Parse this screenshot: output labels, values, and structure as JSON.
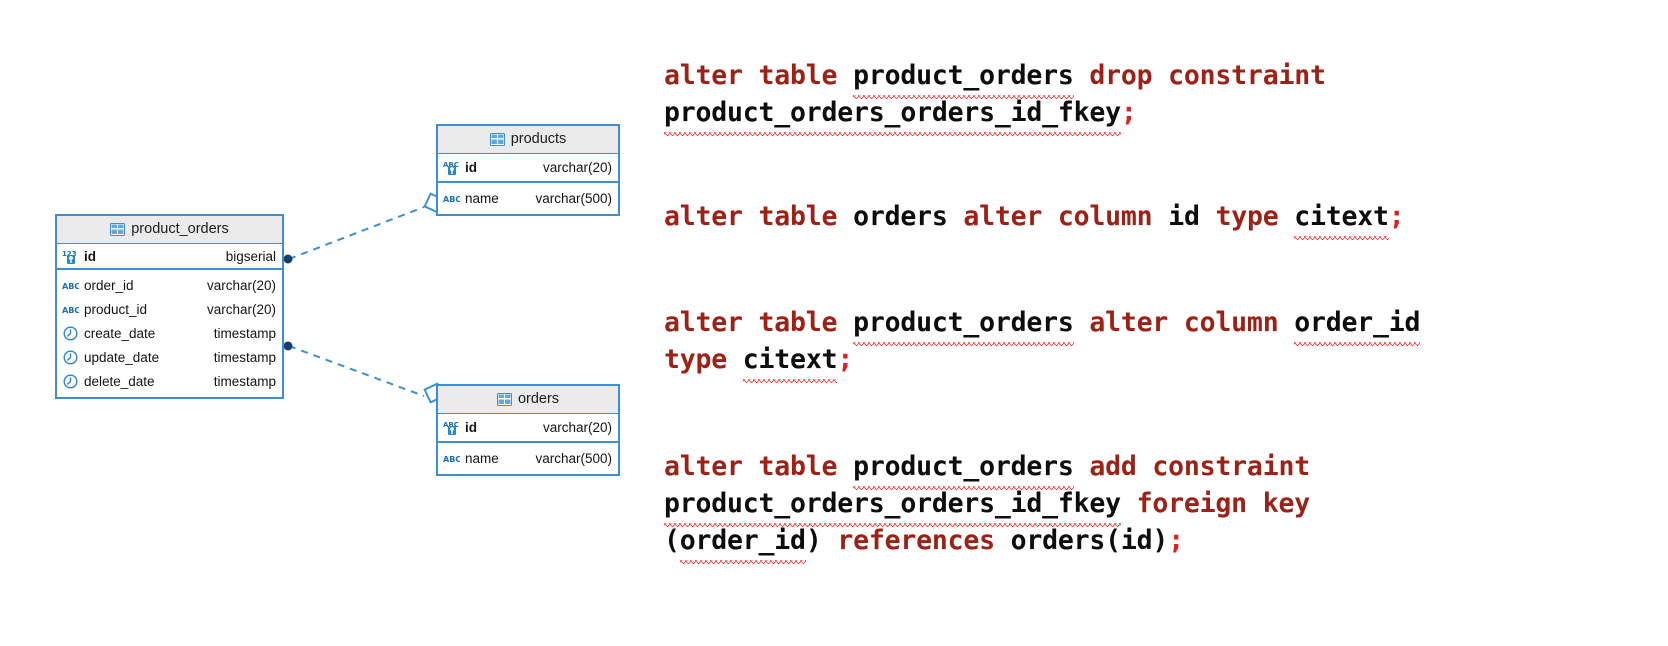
{
  "diagram": {
    "title": "er-diagram",
    "accent_color": "#3f8fd0",
    "header_bg": "#ebebeb",
    "entities": [
      {
        "name": "product_orders",
        "icon": "table-icon",
        "pk": {
          "icon": "number-key-icon",
          "name": "id",
          "type": "bigserial"
        },
        "columns": [
          {
            "icon": "abc-icon",
            "name": "order_id",
            "type": "varchar(20)"
          },
          {
            "icon": "abc-icon",
            "name": "product_id",
            "type": "varchar(20)"
          },
          {
            "icon": "clock-icon",
            "name": "create_date",
            "type": "timestamp"
          },
          {
            "icon": "clock-icon",
            "name": "update_date",
            "type": "timestamp"
          },
          {
            "icon": "clock-icon",
            "name": "delete_date",
            "type": "timestamp"
          }
        ]
      },
      {
        "name": "products",
        "icon": "table-icon",
        "pk": {
          "icon": "abc-key-icon",
          "name": "id",
          "type": "varchar(20)"
        },
        "columns": [
          {
            "icon": "abc-icon",
            "name": "name",
            "type": "varchar(500)"
          }
        ]
      },
      {
        "name": "orders",
        "icon": "table-icon",
        "pk": {
          "icon": "abc-key-icon",
          "name": "id",
          "type": "varchar(20)"
        },
        "columns": [
          {
            "icon": "abc-icon",
            "name": "name",
            "type": "varchar(500)"
          }
        ]
      }
    ],
    "relationships": [
      {
        "from": "product_orders",
        "to": "products",
        "from_marker": "filled-dot",
        "to_marker": "open-diamond",
        "style": "dashed"
      },
      {
        "from": "product_orders",
        "to": "orders",
        "from_marker": "filled-dot",
        "to_marker": "open-diamond",
        "style": "dashed"
      }
    ]
  },
  "sql": {
    "keyword_color": "#9d2117",
    "identifier_color": "#0d0d0d",
    "punctuation_color": "#e02020",
    "statements": [
      {
        "id": "drop-fk-constraint",
        "text": "alter table product_orders drop constraint product_orders_orders_id_fkey;",
        "lines": [
          [
            {
              "t": "alter table ",
              "c": "kw"
            },
            {
              "t": "product_orders",
              "c": "idn",
              "sq": true
            },
            {
              "t": " ",
              "c": "idn"
            },
            {
              "t": "drop constraint",
              "c": "kw"
            }
          ],
          [
            {
              "t": "product_orders_orders_id_fkey",
              "c": "idn",
              "sq": true
            },
            {
              "t": ";",
              "c": "pun"
            }
          ]
        ]
      },
      {
        "id": "alter-orders-id-citext",
        "text": "alter table orders alter column id type citext;",
        "lines": [
          [
            {
              "t": "alter table ",
              "c": "kw"
            },
            {
              "t": "orders",
              "c": "idn"
            },
            {
              "t": " ",
              "c": "idn"
            },
            {
              "t": "alter column",
              "c": "kw"
            },
            {
              "t": " ",
              "c": "idn"
            },
            {
              "t": "id",
              "c": "idn"
            },
            {
              "t": " ",
              "c": "idn"
            },
            {
              "t": "type",
              "c": "kw"
            },
            {
              "t": " ",
              "c": "idn"
            },
            {
              "t": "citext",
              "c": "idn",
              "sq": true
            },
            {
              "t": ";",
              "c": "pun"
            }
          ]
        ]
      },
      {
        "id": "alter-product-orders-order-id-citext",
        "text": "alter table product_orders alter column order_id type citext;",
        "lines": [
          [
            {
              "t": "alter table ",
              "c": "kw"
            },
            {
              "t": "product_orders",
              "c": "idn",
              "sq": true
            },
            {
              "t": " ",
              "c": "idn"
            },
            {
              "t": "alter column",
              "c": "kw"
            },
            {
              "t": " ",
              "c": "idn"
            },
            {
              "t": "order_id",
              "c": "idn",
              "sq": true
            }
          ],
          [
            {
              "t": "type",
              "c": "kw"
            },
            {
              "t": " ",
              "c": "idn"
            },
            {
              "t": "citext",
              "c": "idn",
              "sq": true
            },
            {
              "t": ";",
              "c": "pun"
            }
          ]
        ]
      },
      {
        "id": "add-fk-constraint",
        "text": "alter table product_orders add constraint product_orders_orders_id_fkey foreign key (order_id) references orders(id);",
        "lines": [
          [
            {
              "t": "alter table ",
              "c": "kw"
            },
            {
              "t": "product_orders",
              "c": "idn",
              "sq": true
            },
            {
              "t": " ",
              "c": "idn"
            },
            {
              "t": "add constraint",
              "c": "kw"
            }
          ],
          [
            {
              "t": "product_orders_orders_id_fkey",
              "c": "idn",
              "sq": true
            },
            {
              "t": " ",
              "c": "idn"
            },
            {
              "t": "foreign key",
              "c": "kw"
            }
          ],
          [
            {
              "t": "(",
              "c": "idn"
            },
            {
              "t": "order_id",
              "c": "idn",
              "sq": true
            },
            {
              "t": ") ",
              "c": "idn"
            },
            {
              "t": "references",
              "c": "kw"
            },
            {
              "t": " ",
              "c": "idn"
            },
            {
              "t": "orders(id)",
              "c": "idn"
            },
            {
              "t": ";",
              "c": "pun"
            }
          ]
        ]
      }
    ]
  }
}
